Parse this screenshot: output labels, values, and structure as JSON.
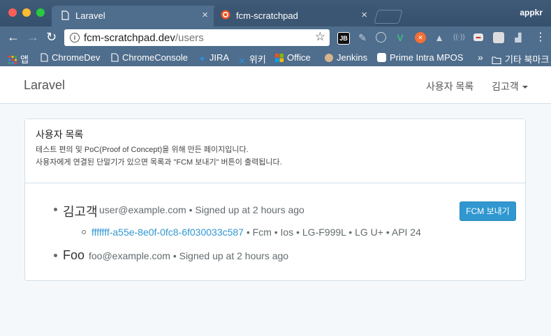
{
  "browser": {
    "tabs": [
      {
        "title": "Laravel",
        "active": true
      },
      {
        "title": "fcm-scratchpad",
        "active": false
      }
    ],
    "profile_name": "appkr",
    "url": {
      "host": "fcm-scratchpad.dev",
      "path": "/users"
    },
    "extensions": [
      "jetbrains-icon",
      "feather-icon",
      "clock-icon",
      "vue-icon",
      "postman-icon",
      "drive-icon",
      "cast-icon",
      "card-icon",
      "grid-icon",
      "chart-icon"
    ],
    "bookmarks": [
      {
        "label": "앱",
        "icon": "apps-grid-icon"
      },
      {
        "label": "ChromeDev",
        "icon": "page-icon"
      },
      {
        "label": "ChromeConsole",
        "icon": "page-icon"
      },
      {
        "label": "JIRA",
        "icon": "jira-icon"
      },
      {
        "label": "위키",
        "icon": "wiki-icon"
      },
      {
        "label": "Office",
        "icon": "office-icon"
      },
      {
        "label": "Jenkins",
        "icon": "jenkins-icon"
      },
      {
        "label": "Prime Intra MPOS",
        "icon": "prime-icon"
      }
    ],
    "bookmarks_overflow": "»",
    "other_bookmarks": "기타 북마크"
  },
  "app": {
    "brand": "Laravel",
    "nav_users": "사용자 목록",
    "nav_user": "김고객"
  },
  "panel": {
    "title": "사용자 목록",
    "desc_line1": "테스트 편의 및 PoC(Proof of Concept)을 위해 만든 페이지입니다.",
    "desc_line2": "사용자에게 연결된 단말기가 있으면 목록과 \"FCM 보내기\" 버튼이 출력됩니다."
  },
  "users": [
    {
      "name": "김고객",
      "meta": "user@example.com • Signed up at 2 hours ago",
      "button": "FCM 보내기",
      "device": {
        "id": "fffffff-a55e-8e0f-0fc8-6f030033c587",
        "info": " • Fcm • Ios • LG-F999L • LG U+ • API 24"
      }
    },
    {
      "name": "Foo",
      "meta": "foo@example.com • Signed up at 2 hours ago"
    }
  ],
  "colors": {
    "accent": "#3097d1",
    "chrome": "#4f6d8c"
  }
}
